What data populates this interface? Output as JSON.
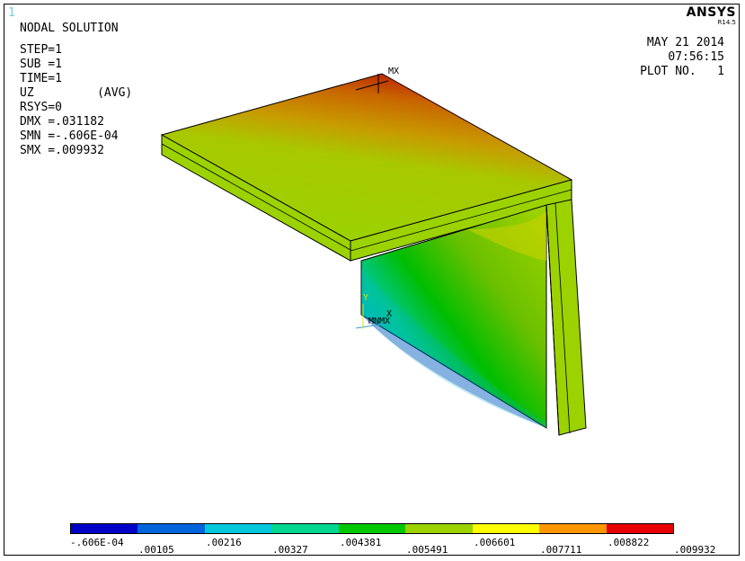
{
  "window_number": "1",
  "logo": {
    "brand": "ANSYS",
    "version": "R14.5"
  },
  "info": {
    "title": "NODAL SOLUTION",
    "lines": [
      "STEP=1",
      "SUB =1",
      "TIME=1",
      "UZ         (AVG)",
      "RSYS=0",
      "DMX =.031182",
      "SMN =-.606E-04",
      "SMX =.009932"
    ]
  },
  "plot_info": {
    "date": "MAY 21 2014",
    "time": "07:56:15",
    "plot_no": "PLOT NO.   1"
  },
  "markers": {
    "max_top": "MX",
    "min_label": "MN",
    "max_bottom": "MX",
    "axis_y": "Y",
    "axis_x": "X"
  },
  "contour_colors": [
    "#0000c8",
    "#0064dc",
    "#00c8dc",
    "#00d790",
    "#00c800",
    "#9bd200",
    "#ffff00",
    "#ff9600",
    "#e60000"
  ],
  "legend": {
    "ticks_top": [
      "-.606E-04",
      ".00216",
      ".004381",
      ".006601",
      ".008822"
    ],
    "ticks_bottom": [
      ".00105",
      ".00327",
      ".005491",
      ".007711",
      ".009932"
    ]
  }
}
